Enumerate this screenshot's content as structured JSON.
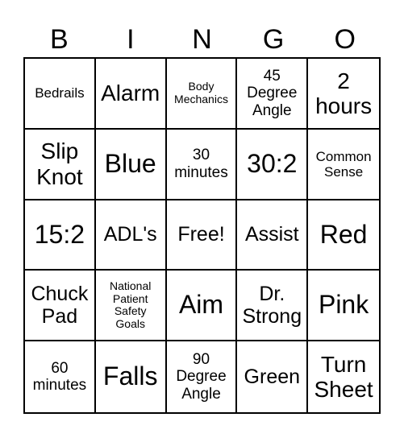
{
  "header": {
    "letters": [
      "B",
      "I",
      "N",
      "G",
      "O"
    ]
  },
  "board": {
    "cells": [
      {
        "text": "Bedrails",
        "size": "s-sm"
      },
      {
        "text": "Alarm",
        "size": "s-xl"
      },
      {
        "text": "Body\nMechanics",
        "size": "s-xs"
      },
      {
        "text": "45\nDegree\nAngle",
        "size": "s-md"
      },
      {
        "text": "2\nhours",
        "size": "s-xl"
      },
      {
        "text": "Slip\nKnot",
        "size": "s-xl"
      },
      {
        "text": "Blue",
        "size": "s-xxl"
      },
      {
        "text": "30\nminutes",
        "size": "s-md"
      },
      {
        "text": "30:2",
        "size": "s-xxl"
      },
      {
        "text": "Common\nSense",
        "size": "s-sm"
      },
      {
        "text": "15:2",
        "size": "s-xxl"
      },
      {
        "text": "ADL's",
        "size": "s-lg"
      },
      {
        "text": "Free!",
        "size": "s-lg"
      },
      {
        "text": "Assist",
        "size": "s-lg"
      },
      {
        "text": "Red",
        "size": "s-xxl"
      },
      {
        "text": "Chuck\nPad",
        "size": "s-lg"
      },
      {
        "text": "National\nPatient\nSafety\nGoals",
        "size": "s-xs"
      },
      {
        "text": "Aim",
        "size": "s-xxl"
      },
      {
        "text": "Dr.\nStrong",
        "size": "s-lg"
      },
      {
        "text": "Pink",
        "size": "s-xxl"
      },
      {
        "text": "60\nminutes",
        "size": "s-md"
      },
      {
        "text": "Falls",
        "size": "s-xxl"
      },
      {
        "text": "90\nDegree\nAngle",
        "size": "s-md"
      },
      {
        "text": "Green",
        "size": "s-lg"
      },
      {
        "text": "Turn\nSheet",
        "size": "s-xl"
      }
    ]
  }
}
